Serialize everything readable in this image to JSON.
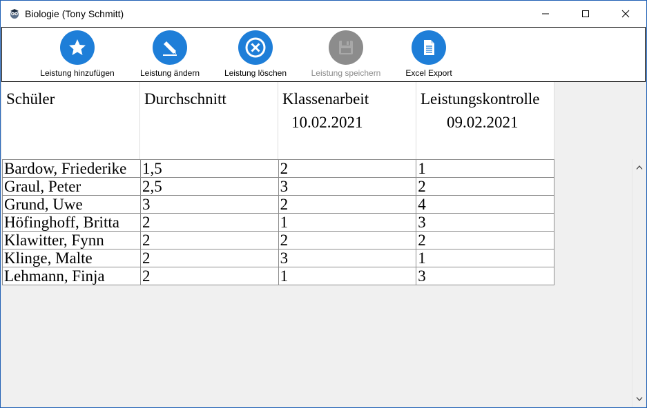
{
  "window": {
    "title": "Biologie (Tony Schmitt)",
    "icon": "owl-app-icon"
  },
  "toolbar": {
    "buttons": [
      {
        "label": "Leistung hinzufügen",
        "icon": "star-icon",
        "enabled": true
      },
      {
        "label": "Leistung ändern",
        "icon": "pencil-icon",
        "enabled": true
      },
      {
        "label": "Leistung löschen",
        "icon": "delete-x-icon",
        "enabled": true
      },
      {
        "label": "Leistung speichern",
        "icon": "save-icon",
        "enabled": false
      },
      {
        "label": "Excel Export",
        "icon": "document-icon",
        "enabled": true
      }
    ]
  },
  "grid": {
    "headers": [
      {
        "line1": "Schüler",
        "line2": ""
      },
      {
        "line1": "Durchschnitt",
        "line2": ""
      },
      {
        "line1": "Klassenarbeit",
        "line2": "10.02.2021"
      },
      {
        "line1": "Leistungskontrolle",
        "line2": "09.02.2021"
      }
    ],
    "rows": [
      [
        "Bardow, Friederike",
        "1,5",
        "2",
        "1"
      ],
      [
        "Graul, Peter",
        "2,5",
        "3",
        "2"
      ],
      [
        "Grund, Uwe",
        "3",
        "2",
        "4"
      ],
      [
        "Höfinghoff, Britta",
        "2",
        "1",
        "3"
      ],
      [
        "Klawitter, Fynn",
        "2",
        "2",
        "2"
      ],
      [
        "Klinge, Malte",
        "2",
        "3",
        "1"
      ],
      [
        "Lehmann, Finja",
        "2",
        "1",
        "3"
      ]
    ]
  },
  "colors": {
    "accent": "#1e7ed8",
    "disabled": "#8c8c8c",
    "window_border": "#1e5fb4"
  }
}
